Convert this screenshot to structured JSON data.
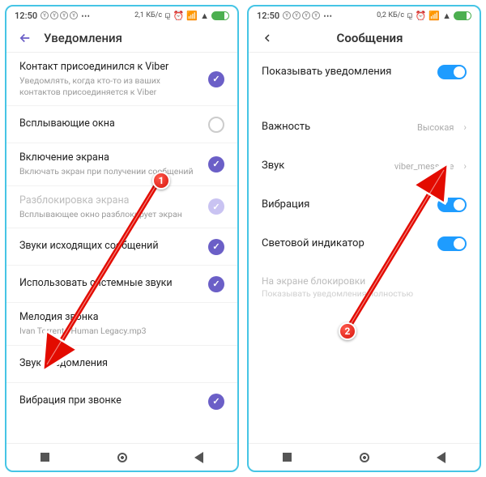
{
  "statusbar": {
    "time": "12:50",
    "net_left": "2,1 КБ/с",
    "net_right": "0,2 КБ/с"
  },
  "left": {
    "title": "Уведомления",
    "rows": [
      {
        "title": "Контакт присоединился к Viber",
        "sub": "Уведомлять, когда кто-то из ваших контактов присоединяется к Viber"
      },
      {
        "title": "Всплывающие окна"
      },
      {
        "title": "Включение экрана",
        "sub": "Включать экран при получении сообщений"
      },
      {
        "title": "Разблокировка экрана",
        "sub": "Всплывающее окно разблокирует экран"
      },
      {
        "title": "Звуки исходящих сообщений"
      },
      {
        "title": "Использовать системные звуки"
      },
      {
        "title": "Мелодия звонка",
        "sub": "Ivan Torrent - Human Legacy.mp3"
      },
      {
        "title": "Звук уведомления"
      },
      {
        "title": "Вибрация при звонке"
      }
    ]
  },
  "right": {
    "title": "Сообщения",
    "rows": {
      "show": "Показывать уведомления",
      "importance": "Важность",
      "importance_val": "Высокая",
      "sound": "Звук",
      "sound_val": "viber_message",
      "vibration": "Вибрация",
      "led": "Световой индикатор",
      "lock_title": "На экране блокировки",
      "lock_sub": "Показывать уведомления полностью"
    }
  },
  "badges": {
    "one": "1",
    "two": "2"
  }
}
